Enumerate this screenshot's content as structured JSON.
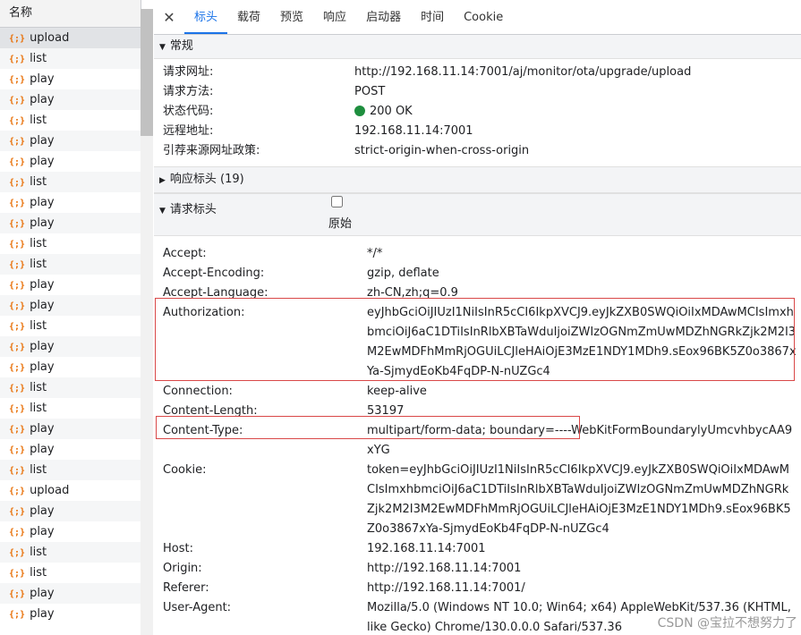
{
  "left": {
    "header": "名称",
    "requests": [
      "upload",
      "list",
      "play",
      "play",
      "list",
      "play",
      "play",
      "list",
      "play",
      "play",
      "list",
      "list",
      "play",
      "play",
      "list",
      "play",
      "play",
      "list",
      "list",
      "play",
      "play",
      "list",
      "upload",
      "play",
      "play",
      "list",
      "list",
      "play",
      "play"
    ]
  },
  "tabs": [
    "标头",
    "载荷",
    "预览",
    "响应",
    "启动器",
    "时间",
    "Cookie"
  ],
  "general": {
    "title": "常规",
    "rows": [
      {
        "k": "请求网址:",
        "v": "http://192.168.11.14:7001/aj/monitor/ota/upgrade/upload"
      },
      {
        "k": "请求方法:",
        "v": "POST"
      },
      {
        "k": "状态代码:",
        "v": "200 OK"
      },
      {
        "k": "远程地址:",
        "v": "192.168.11.14:7001"
      },
      {
        "k": "引荐来源网址政策:",
        "v": "strict-origin-when-cross-origin"
      }
    ]
  },
  "response_headers": {
    "title": "响应标头 (19)"
  },
  "request_headers": {
    "title": "请求标头",
    "raw_label": "原始",
    "rows": [
      {
        "k": "Accept:",
        "v": "*/*"
      },
      {
        "k": "Accept-Encoding:",
        "v": "gzip, deflate"
      },
      {
        "k": "Accept-Language:",
        "v": "zh-CN,zh;q=0.9"
      },
      {
        "k": "Authorization:",
        "v": "eyJhbGciOiJIUzI1NiIsInR5cCI6IkpXVCJ9.eyJkZXB0SWQiOiIxMDAwMCIsImxhbmciOiJ6aC1DTiIsInRlbXBTaWduIjoiZWIzOGNmZmUwMDZhNGRkZjk2M2I3M2EwMDFhMmRjOGUiLCJleHAiOjE3MzE1NDY1MDh9.sEox96BK5Z0o3867xYa-SjmydEoKb4FqDP-N-nUZGc4"
      },
      {
        "k": "Connection:",
        "v": "keep-alive"
      },
      {
        "k": "Content-Length:",
        "v": "53197"
      },
      {
        "k": "Content-Type:",
        "v": "multipart/form-data; boundary=----WebKitFormBoundarylyUmcvhbycAA9xYG"
      },
      {
        "k": "Cookie:",
        "v": "token=eyJhbGciOiJIUzI1NiIsInR5cCI6IkpXVCJ9.eyJkZXB0SWQiOiIxMDAwMCIsImxhbmciOiJ6aC1DTiIsInRlbXBTaWduIjoiZWIzOGNmZmUwMDZhNGRkZjk2M2I3M2EwMDFhMmRjOGUiLCJleHAiOjE3MzE1NDY1MDh9.sEox96BK5Z0o3867xYa-SjmydEoKb4FqDP-N-nUZGc4"
      },
      {
        "k": "Host:",
        "v": "192.168.11.14:7001"
      },
      {
        "k": "Origin:",
        "v": "http://192.168.11.14:7001"
      },
      {
        "k": "Referer:",
        "v": "http://192.168.11.14:7001/"
      },
      {
        "k": "User-Agent:",
        "v": "Mozilla/5.0 (Windows NT 10.0; Win64; x64) AppleWebKit/537.36 (KHTML, like Gecko) Chrome/130.0.0.0 Safari/537.36"
      }
    ]
  },
  "watermark": "CSDN @宝拉不想努力了",
  "colors": {
    "accent": "#1a73e8",
    "status_ok": "#1e8e3e",
    "highlight_box": "#d94848",
    "request_icon": "#e8710a"
  }
}
